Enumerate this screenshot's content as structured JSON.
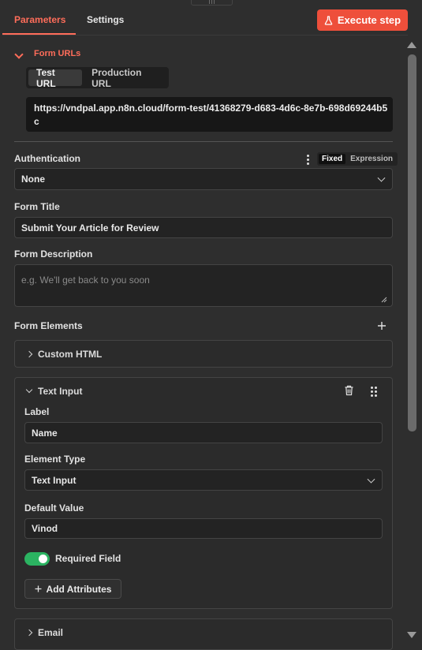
{
  "tabs": {
    "parameters": "Parameters",
    "settings": "Settings"
  },
  "execute_button": {
    "label": "Execute step",
    "icon": "flask-icon"
  },
  "form_urls": {
    "section_title": "Form URLs",
    "test_url_label": "Test URL",
    "production_url_label": "Production URL",
    "active": "Test URL",
    "url_line1": "https://vndpal.app.n8n.cloud/form-test/41368279-d683-4d6c-8e7b-698d69244b5",
    "url_line2": "c"
  },
  "authentication": {
    "label": "Authentication",
    "fixed": "Fixed",
    "expression": "Expression",
    "value": "None"
  },
  "form_title": {
    "label": "Form Title",
    "value": "Submit Your Article for Review"
  },
  "form_description": {
    "label": "Form Description",
    "placeholder": "e.g. We'll get back to you soon"
  },
  "form_elements": {
    "label": "Form Elements",
    "items": [
      {
        "title": "Custom HTML",
        "expanded": false
      },
      {
        "title": "Text Input",
        "expanded": true,
        "label_label": "Label",
        "label_value": "Name",
        "element_type_label": "Element Type",
        "element_type_value": "Text Input",
        "default_value_label": "Default Value",
        "default_value": "Vinod",
        "required_label": "Required Field",
        "required": true,
        "add_attributes": "Add Attributes"
      },
      {
        "title": "Email",
        "expanded": false
      }
    ]
  },
  "colors": {
    "accent": "#ff6d5a",
    "execute": "#ee4f3b",
    "toggle_on": "#2bb361"
  }
}
